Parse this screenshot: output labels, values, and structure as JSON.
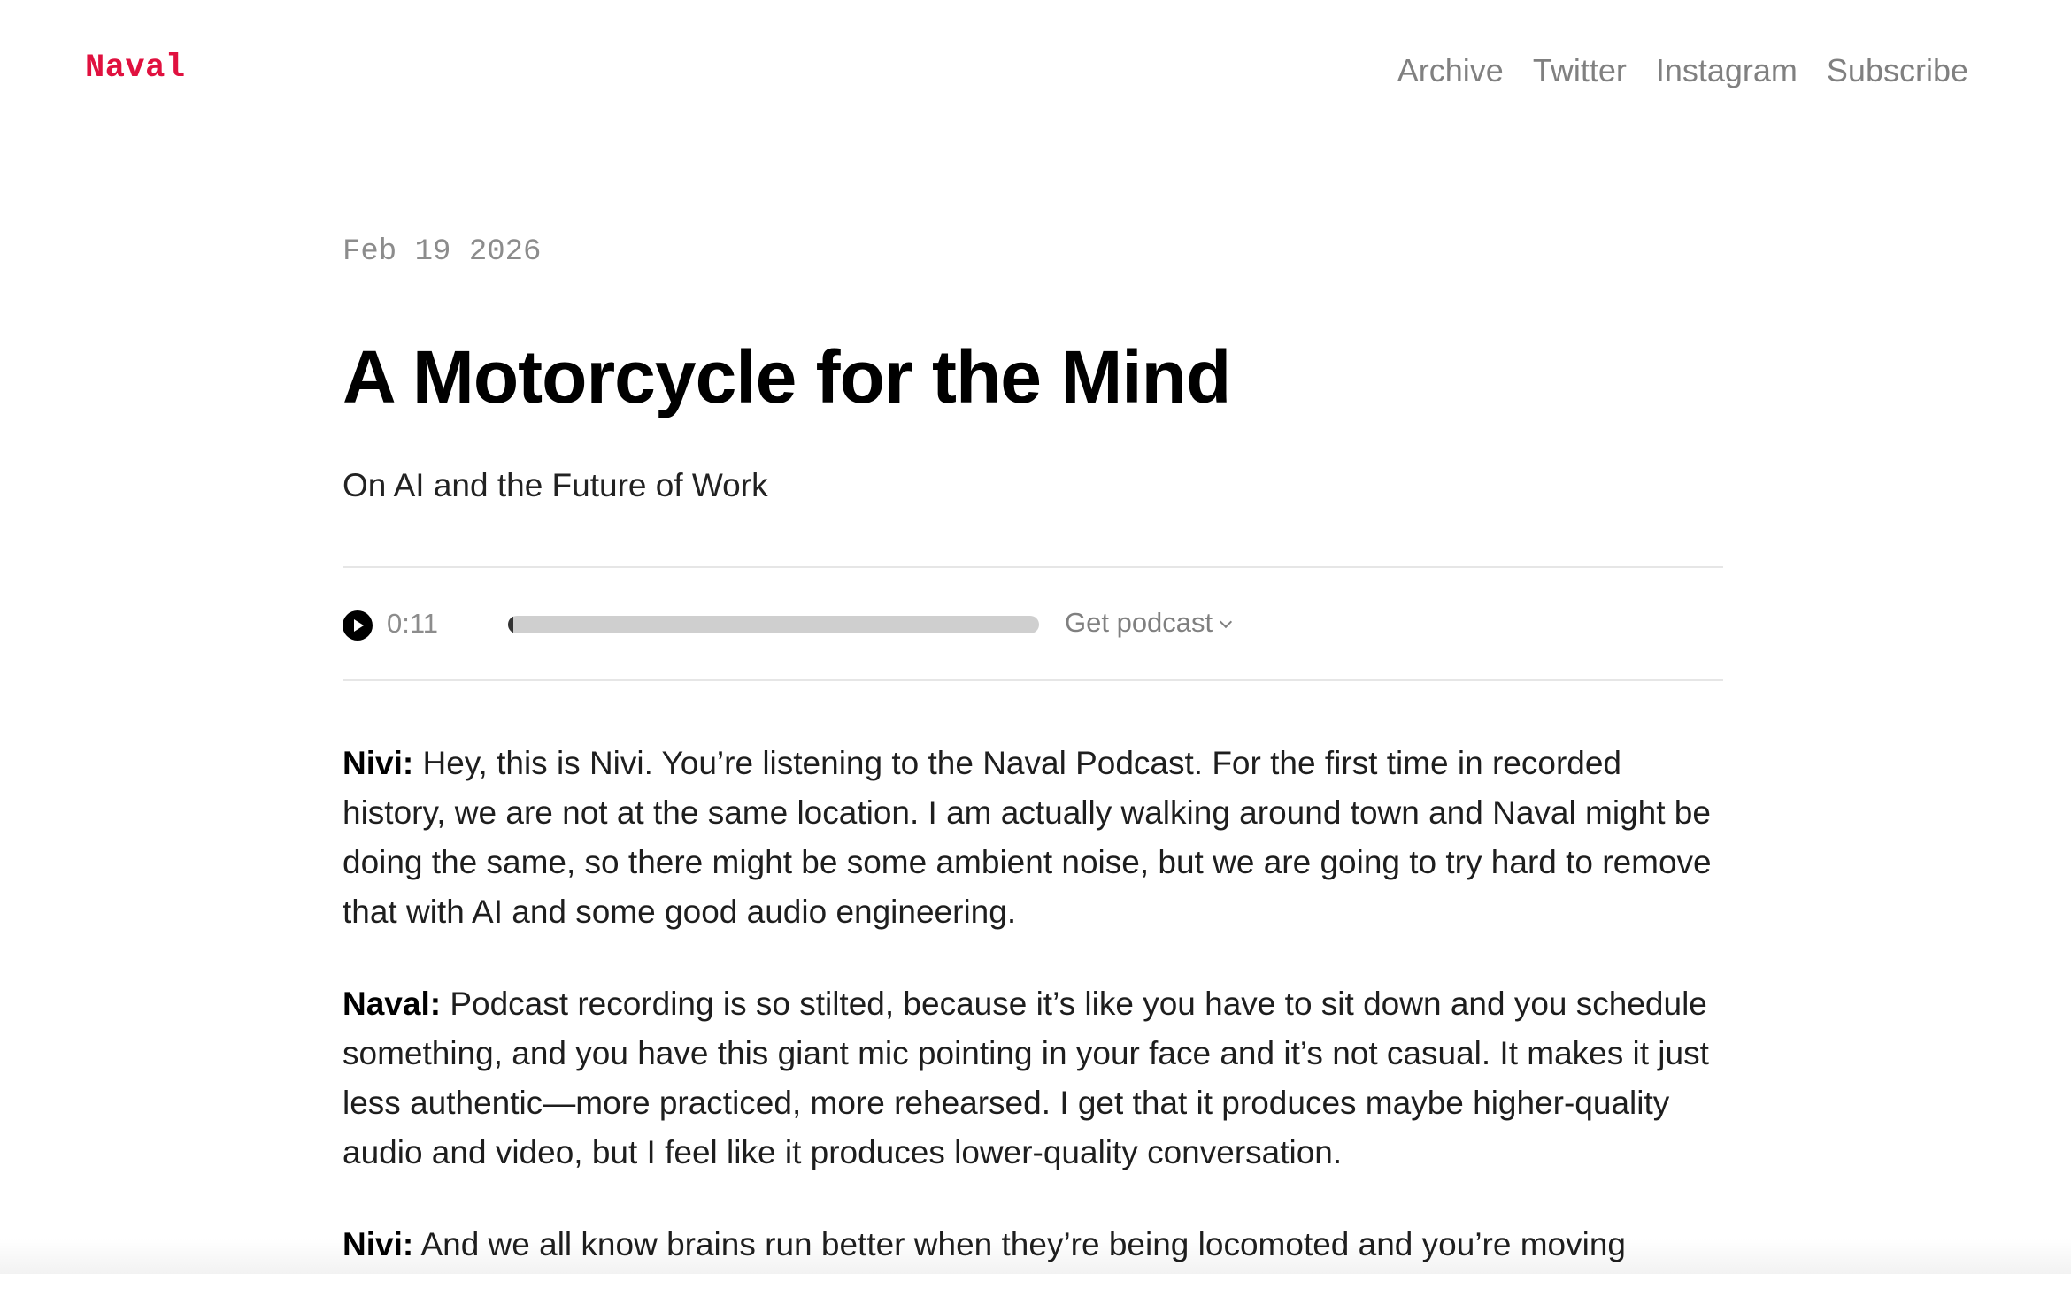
{
  "header": {
    "logo": "Naval",
    "nav": [
      "Archive",
      "Twitter",
      "Instagram",
      "Subscribe"
    ]
  },
  "article": {
    "date": "Feb 19 2026",
    "title": "A Motorcycle for the Mind",
    "subtitle": "On AI and the Future of Work",
    "player": {
      "time": "0:11",
      "progress": 0.01,
      "get_podcast_label": "Get podcast"
    },
    "paragraphs": [
      {
        "speaker": "Nivi:",
        "text": "Hey, this is Nivi. You’re listening to the Naval Podcast. For the first time in recorded history, we are not at the same location. I am actually walking around town and Naval might be doing the same, so there might be some ambient noise, but we are going to try hard to remove that with AI and some good audio engineering."
      },
      {
        "speaker": "Naval:",
        "text": "Podcast recording is so stilted, because it’s like you have to sit down and you schedule something, and you have this giant mic pointing in your face and it’s not casual. It makes it just less authentic—more practiced, more rehearsed. I get that it produces maybe higher-quality audio and video, but I feel like it produces lower-quality conversation."
      },
      {
        "speaker": "Nivi:",
        "text": "And we all know brains run better when they’re being locomoted and you’re moving"
      }
    ]
  },
  "colors": {
    "logo": "#e0113f",
    "nav_text": "#808080",
    "progress_track": "#cfcfcf"
  },
  "icons": {
    "play": "play-icon",
    "dropdown": "chevron-down-icon"
  }
}
